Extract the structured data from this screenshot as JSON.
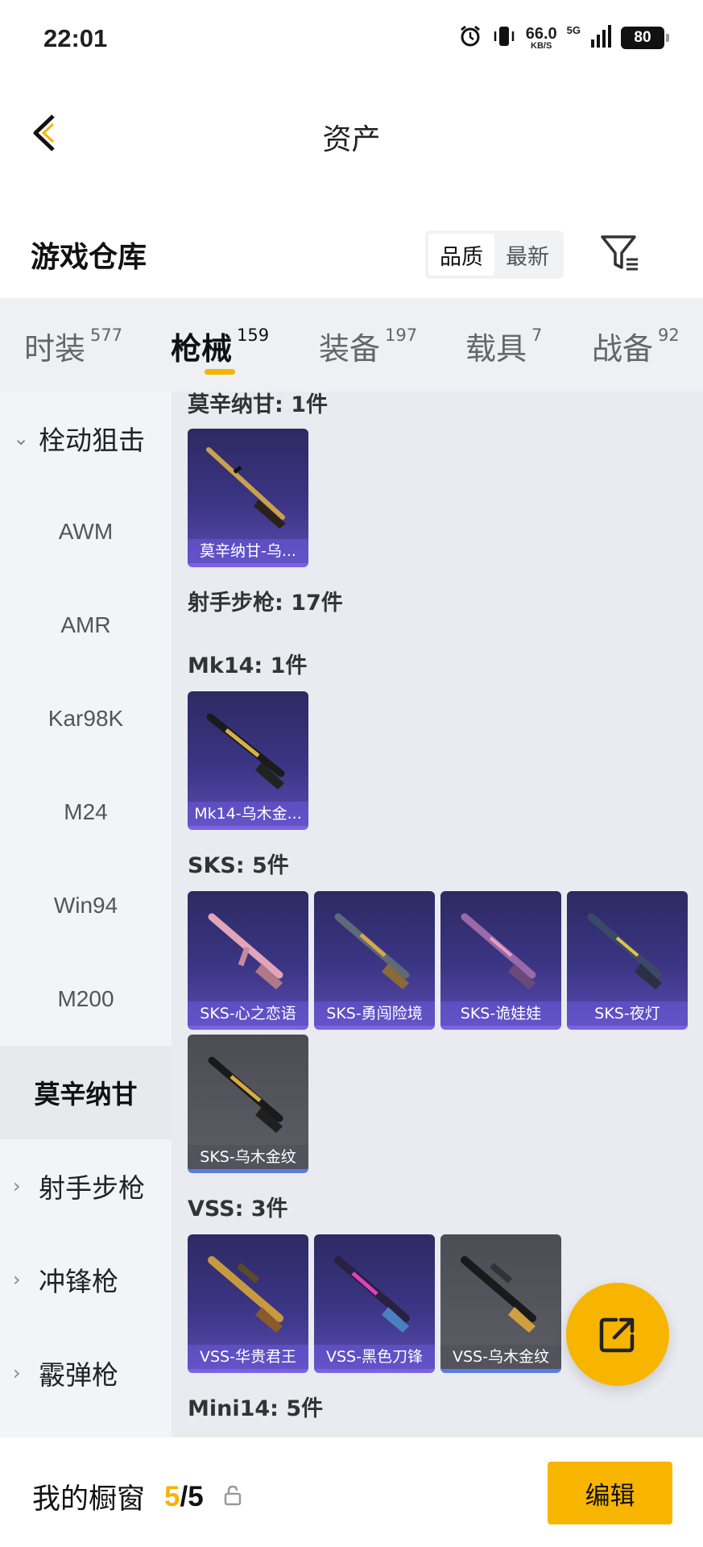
{
  "status": {
    "time": "22:01",
    "net_speed": "66.0",
    "net_unit": "KB/S",
    "network": "5G",
    "battery": "80"
  },
  "nav": {
    "title": "资产"
  },
  "header": {
    "title": "游戏仓库",
    "sort_options": [
      "品质",
      "最新"
    ]
  },
  "tabs": [
    {
      "label": "时装",
      "count": "577"
    },
    {
      "label": "枪械",
      "count": "159"
    },
    {
      "label": "装备",
      "count": "197"
    },
    {
      "label": "载具",
      "count": "7"
    },
    {
      "label": "战备",
      "count": "92"
    }
  ],
  "sidebar": {
    "group_bolt": "栓动狙击",
    "subs": [
      "AWM",
      "AMR",
      "Kar98K",
      "M24",
      "Win94",
      "M200",
      "莫辛纳甘"
    ],
    "group_dmr": "射手步枪",
    "group_smg": "冲锋枪",
    "group_shotgun": "霰弹枪"
  },
  "content": {
    "sec_mosin": "莫辛纳甘: 1件",
    "mosin_items": [
      "莫辛纳甘-乌..."
    ],
    "sec_dmr": "射手步枪: 17件",
    "sec_mk14": "Mk14: 1件",
    "mk14_items": [
      "Mk14-乌木金..."
    ],
    "sec_sks": "SKS: 5件",
    "sks_items": [
      "SKS-心之恋语",
      "SKS-勇闯险境",
      "SKS-诡娃娃",
      "SKS-夜灯",
      "SKS-乌木金纹"
    ],
    "sec_vss": "VSS: 3件",
    "vss_items": [
      "VSS-华贵君王",
      "VSS-黑色刀锋",
      "VSS-乌木金纹"
    ],
    "sec_mini14": "Mini14: 5件"
  },
  "bottom": {
    "label": "我的橱窗",
    "count_used": "5",
    "count_sep": "/",
    "count_total": "5",
    "edit_label": "编辑"
  },
  "colors": {
    "accent": "#f5b400",
    "card_purple": "#3b3584",
    "card_grey": "#55555e"
  }
}
